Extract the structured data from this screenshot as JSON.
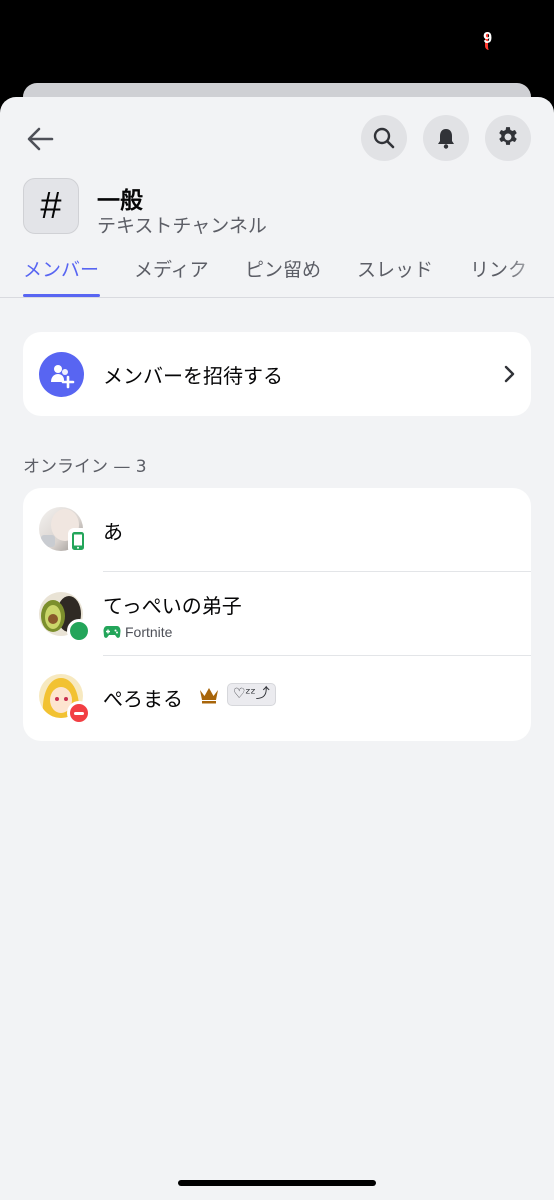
{
  "status_bar": {
    "battery": "9"
  },
  "header": {
    "back_icon": "arrow-left-icon",
    "search_icon": "search-icon",
    "notification_icon": "bell-icon",
    "settings_icon": "gear-icon"
  },
  "channel": {
    "symbol": "#",
    "name": "一般",
    "type": "テキストチャンネル"
  },
  "tabs": [
    {
      "label": "メンバー",
      "active": true
    },
    {
      "label": "メディア",
      "active": false
    },
    {
      "label": "ピン留め",
      "active": false
    },
    {
      "label": "スレッド",
      "active": false
    },
    {
      "label": "リンク",
      "active": false
    }
  ],
  "invite": {
    "label": "メンバーを招待する"
  },
  "online_section": {
    "header": "オンライン — 3"
  },
  "members": [
    {
      "name": "あ",
      "status": "mobile",
      "activity": ""
    },
    {
      "name": "てっぺいの弟子",
      "status": "online",
      "activity": "Fortnite"
    },
    {
      "name": "ぺろまる",
      "status": "dnd",
      "activity": "",
      "badge": "crown-icon",
      "custom_status": "♡ᶻᶻ⤴"
    }
  ],
  "colors": {
    "accent": "#5865f2",
    "online": "#23a55a",
    "dnd": "#f23f43",
    "crown": "#a8650a"
  }
}
